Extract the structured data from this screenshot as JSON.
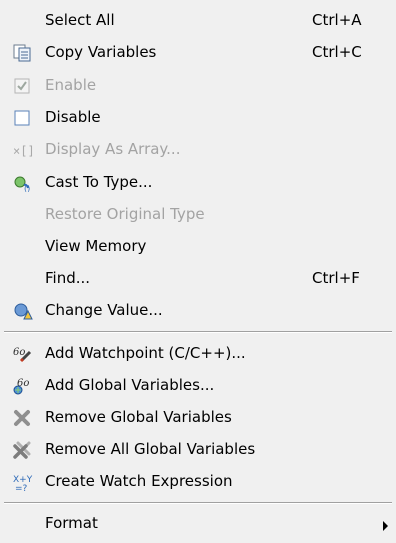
{
  "menu": {
    "items": [
      {
        "label": "Select All",
        "shortcut": "Ctrl+A",
        "enabled": true,
        "icon": "none"
      },
      {
        "label": "Copy Variables",
        "shortcut": "Ctrl+C",
        "enabled": true,
        "icon": "copy-icon"
      },
      {
        "label": "Enable",
        "shortcut": "",
        "enabled": false,
        "icon": "checkbox-checked-icon"
      },
      {
        "label": "Disable",
        "shortcut": "",
        "enabled": true,
        "icon": "checkbox-empty-icon"
      },
      {
        "label": "Display As Array...",
        "shortcut": "",
        "enabled": false,
        "icon": "array-icon"
      },
      {
        "label": "Cast To Type...",
        "shortcut": "",
        "enabled": true,
        "icon": "cast-icon"
      },
      {
        "label": "Restore Original Type",
        "shortcut": "",
        "enabled": false,
        "icon": "none"
      },
      {
        "label": "View Memory",
        "shortcut": "",
        "enabled": true,
        "icon": "none"
      },
      {
        "label": "Find...",
        "shortcut": "Ctrl+F",
        "enabled": true,
        "icon": "none"
      },
      {
        "label": "Change Value...",
        "shortcut": "",
        "enabled": true,
        "icon": "change-value-icon"
      },
      {
        "label": "Add Watchpoint (C/C++)...",
        "shortcut": "",
        "enabled": true,
        "icon": "watchpoint-icon"
      },
      {
        "label": "Add Global Variables...",
        "shortcut": "",
        "enabled": true,
        "icon": "add-global-icon"
      },
      {
        "label": "Remove Global Variables",
        "shortcut": "",
        "enabled": true,
        "icon": "remove-icon"
      },
      {
        "label": "Remove All Global Variables",
        "shortcut": "",
        "enabled": true,
        "icon": "remove-all-icon"
      },
      {
        "label": "Create Watch Expression",
        "shortcut": "",
        "enabled": true,
        "icon": "watch-expression-icon"
      },
      {
        "label": "Format",
        "shortcut": "",
        "enabled": true,
        "icon": "submenu-arrow-icon"
      }
    ]
  },
  "colors": {
    "menu_background": "#f0f0f0",
    "disabled_text": "#a3a3a3",
    "separator": "#a0a0a0"
  }
}
